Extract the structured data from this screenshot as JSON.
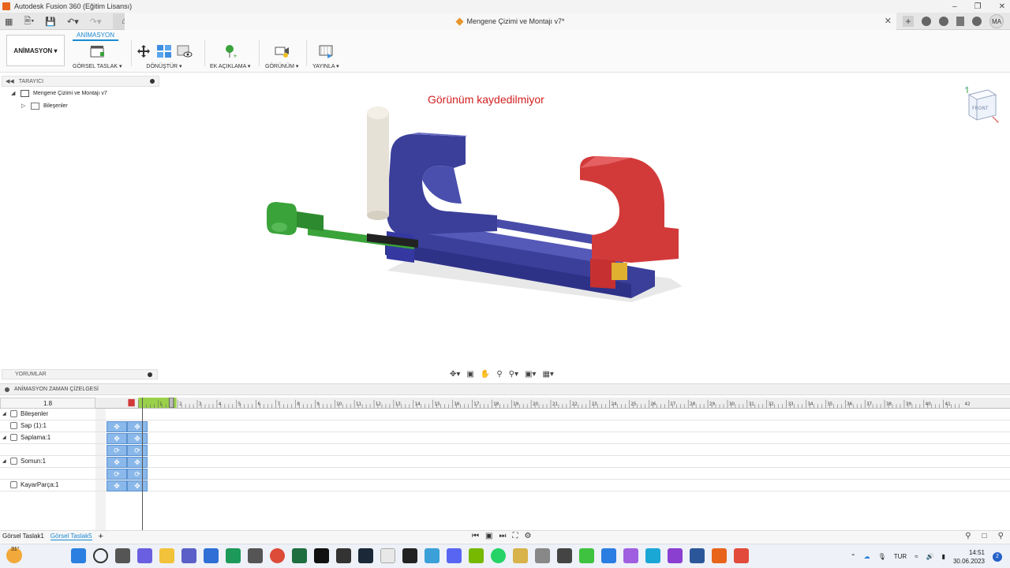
{
  "app": {
    "title": "Autodesk Fusion 360 (Eğitim Lisansı)",
    "document_title": "Mengene Çizimi ve Montajı v7*",
    "user_initials": "MA"
  },
  "toolbar": {
    "workspace": "ANİMASYON",
    "active_tab": "ANİMASYON",
    "groups": {
      "storyboard": "GÖRSEL TASLAK",
      "transform": "DÖNÜŞTÜR",
      "annotation": "EK AÇIKLAMA",
      "view": "GÖRÜNÜM",
      "publish": "YAYINLA"
    }
  },
  "browser": {
    "header": "TARAYICI",
    "root": "Mengene Çizimi ve Montajı v7",
    "components": "Bileşenler"
  },
  "viewport": {
    "status_message": "Görünüm kaydedilmiyor",
    "viewcube_label": "FRONT"
  },
  "comments": {
    "label": "YORUMLAR"
  },
  "timeline": {
    "header": "ANİMASYON ZAMAN ÇİZELGESİ",
    "current_time": "1.8",
    "ruler_ticks": [
      "1",
      "2",
      "3",
      "4",
      "5",
      "6",
      "7",
      "8",
      "9",
      "10",
      "11",
      "12",
      "13",
      "14",
      "15",
      "16",
      "17",
      "18",
      "19",
      "20",
      "21",
      "22",
      "23",
      "24",
      "25",
      "26",
      "27",
      "28",
      "29",
      "30",
      "31",
      "32",
      "33",
      "34",
      "35",
      "36",
      "37",
      "38",
      "39",
      "40",
      "41",
      "42"
    ],
    "rows": [
      {
        "label": "Bileşenler"
      },
      {
        "label": "Sap (1):1"
      },
      {
        "label": "Saplama:1"
      },
      {
        "label": ""
      },
      {
        "label": "Somun:1"
      },
      {
        "label": ""
      },
      {
        "label": "KayarParça:1"
      }
    ]
  },
  "storyboards": {
    "tabs": [
      "Görsel Taslak1",
      "Görsel Taslak5"
    ],
    "active": "Görsel Taslak5",
    "add": "+"
  },
  "taskbar": {
    "temperature": "31°",
    "language": "TUR",
    "time": "14:51",
    "date": "30.06.2023",
    "notifications": "2"
  },
  "colors": {
    "accent": "#1b8ad3",
    "warning_text": "#d11f1f",
    "vise_body": "#3b3f9a",
    "jaw": "#d23a3a",
    "handle": "#3aa33a",
    "keyframe": "#8ab8ea"
  }
}
